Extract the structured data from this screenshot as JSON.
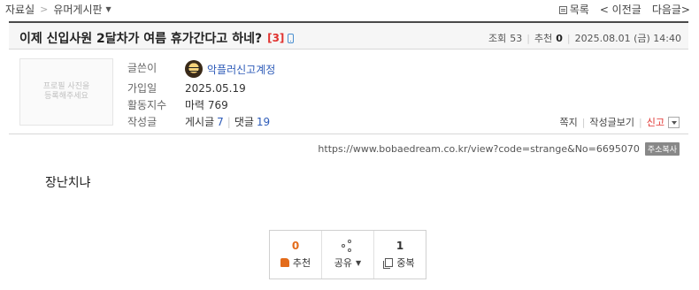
{
  "breadcrumb": {
    "root": "자료실",
    "separator": ">",
    "board": "유머게시판"
  },
  "nav": {
    "list": "목록",
    "prev": "< 이전글",
    "next": "다음글>"
  },
  "post": {
    "title": "이제 신입사원 2달차가 여름 휴가간다고 하네?",
    "comment_count": "[3]",
    "views_label": "조회",
    "views": "53",
    "recommend_label": "추천",
    "recommend": "0",
    "date": "2025.08.01 (금) 14:40",
    "body": "장난치냐",
    "url": "https://www.bobaedream.co.kr/view?code=strange&No=6695070",
    "copy_label": "주소복사"
  },
  "author": {
    "profile_placeholder": "프로필 사진을\n등록해주세요",
    "writer_label": "글쓴이",
    "writer": "악플러신고계정",
    "join_label": "가입일",
    "join_date": "2025.05.19",
    "activity_label": "활동지수",
    "activity": "마력 769",
    "posts_label": "작성글",
    "posts_text": "게시글",
    "posts_count": "7",
    "comments_text": "댓글",
    "comments_count": "19"
  },
  "actions": {
    "note": "쪽지",
    "view_posts": "작성글보기",
    "report": "신고"
  },
  "vote": {
    "recommend_count": "0",
    "recommend_label": "추천",
    "share_label": "공유",
    "duplicate_count": "1",
    "duplicate_label": "중복"
  },
  "colors": {
    "accent_red": "#e0322f",
    "link_blue": "#2d5bb8",
    "orange": "#e36b1a"
  }
}
